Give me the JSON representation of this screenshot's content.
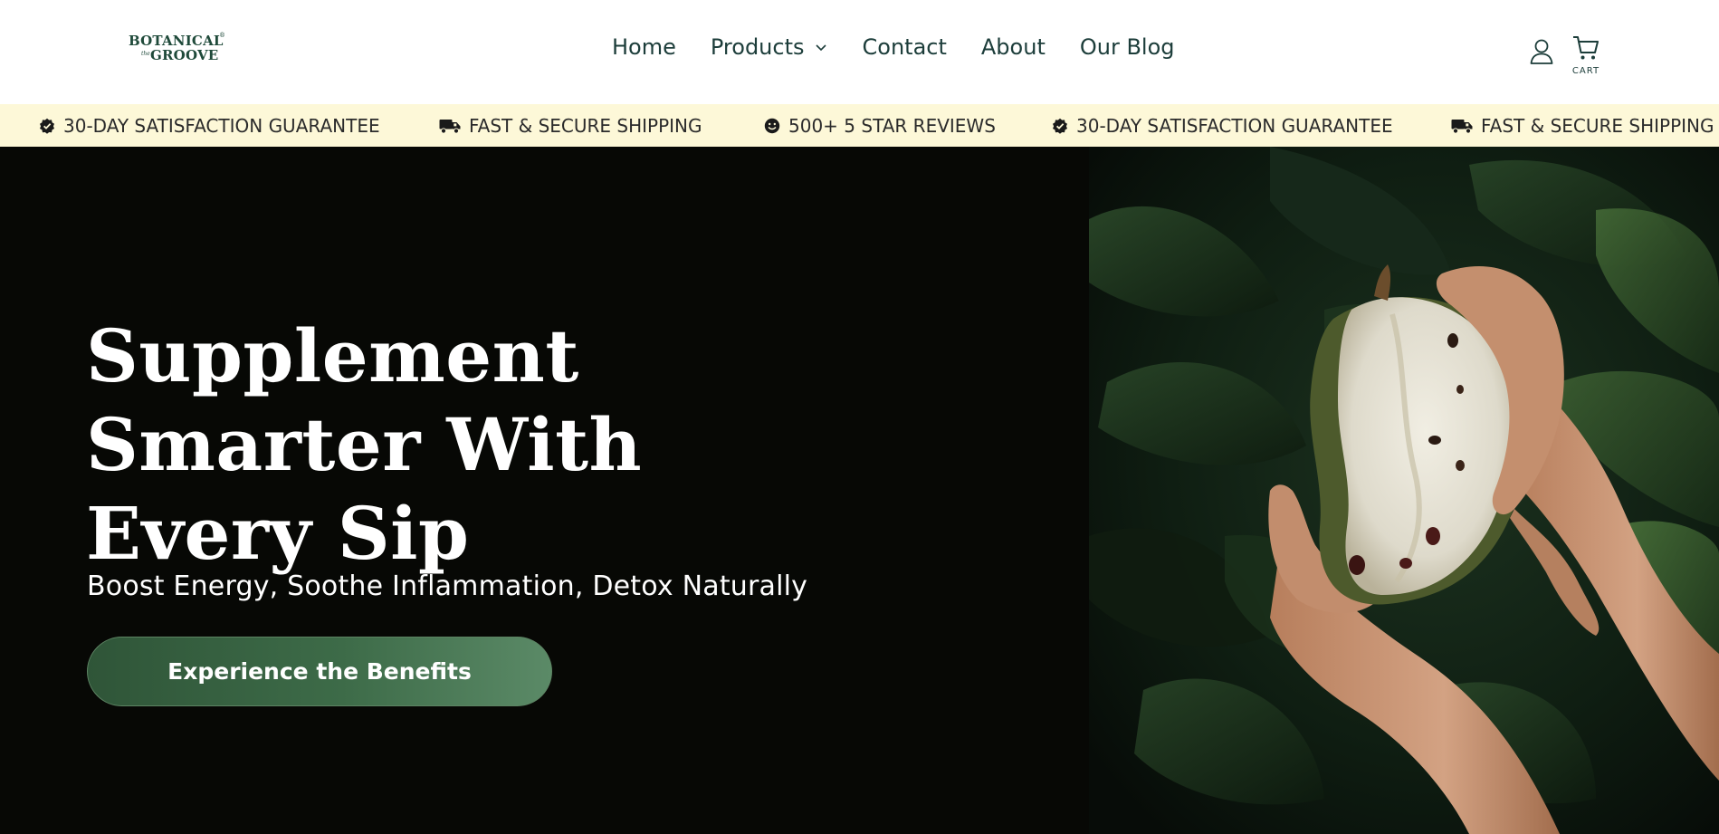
{
  "brand": {
    "logo_line1": "BOTANICAL",
    "logo_line2": "GROOVE",
    "logo_the": "the",
    "logo_reg": "®"
  },
  "nav": {
    "items": [
      {
        "label": "Home"
      },
      {
        "label": "Products",
        "has_dropdown": true
      },
      {
        "label": "Contact"
      },
      {
        "label": "About"
      },
      {
        "label": "Our Blog"
      }
    ]
  },
  "header": {
    "account_icon": "user-icon",
    "cart_icon": "cart-icon",
    "cart_label": "CART"
  },
  "announcements": [
    {
      "icon": "badge-check-icon",
      "text": "30-DAY SATISFACTION GUARANTEE"
    },
    {
      "icon": "truck-icon",
      "text": "FAST & SECURE SHIPPING"
    },
    {
      "icon": "smile-icon",
      "text": "500+ 5 STAR REVIEWS"
    },
    {
      "icon": "badge-check-icon",
      "text": "30-DAY SATISFACTION GUARANTEE"
    },
    {
      "icon": "truck-icon",
      "text": "FAST & SECURE SHIPPING"
    }
  ],
  "hero": {
    "headline_line1": "Supplement",
    "headline_line2": "Smarter With",
    "headline_line3": "Every Sip",
    "subheadline": "Boost Energy, Soothe Inflammation, Detox Naturally",
    "cta_label": "Experience the Benefits"
  },
  "colors": {
    "brand_green": "#1f4a3a",
    "nav_text": "#1c3d3a",
    "announce_bg": "#fdf8d8",
    "hero_bg": "#070805",
    "cta_start": "#2f5538",
    "cta_end": "#5b8a67"
  }
}
